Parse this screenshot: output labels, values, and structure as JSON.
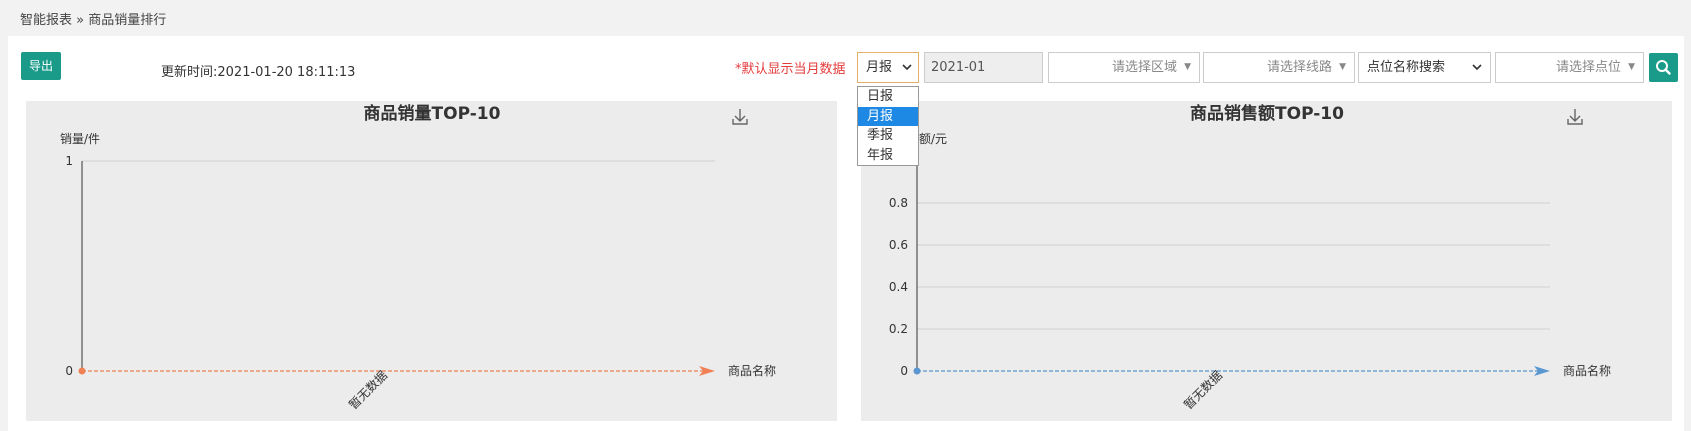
{
  "breadcrumb": {
    "root": "智能报表",
    "separator": "»",
    "current": "商品销量排行"
  },
  "toolbar": {
    "export_label": "导出",
    "update_time": "更新时间:2021-01-20 18:11:13",
    "default_note": "*默认显示当月数据",
    "period": {
      "selected": "月报",
      "options": [
        "日报",
        "月报",
        "季报",
        "年报"
      ]
    },
    "month_value": "2021-01",
    "region_placeholder": "请选择区域",
    "route_placeholder": "请选择线路",
    "point_name_search": "点位名称搜索",
    "point_placeholder": "请选择点位"
  },
  "colors": {
    "accent": "#1a9b8a",
    "left_series": "#f08154",
    "right_series": "#5a97d0",
    "warning": "#e43b3b"
  },
  "chart_data": [
    {
      "type": "bar",
      "title": "商品销量TOP-10",
      "ylabel": "销量/件",
      "xlabel": "商品名称",
      "categories": [
        "暂无数据"
      ],
      "values": [
        0
      ],
      "ylim": [
        0,
        1
      ],
      "yticks": [
        "0",
        "1"
      ],
      "grid": true
    },
    {
      "type": "bar",
      "title": "商品销售额TOP-10",
      "ylabel": "销售额/元",
      "xlabel": "商品名称",
      "categories": [
        "暂无数据"
      ],
      "values": [
        0
      ],
      "ylim": [
        0,
        1
      ],
      "yticks": [
        "0",
        "0.2",
        "0.4",
        "0.6",
        "0.8"
      ],
      "grid": true
    }
  ]
}
